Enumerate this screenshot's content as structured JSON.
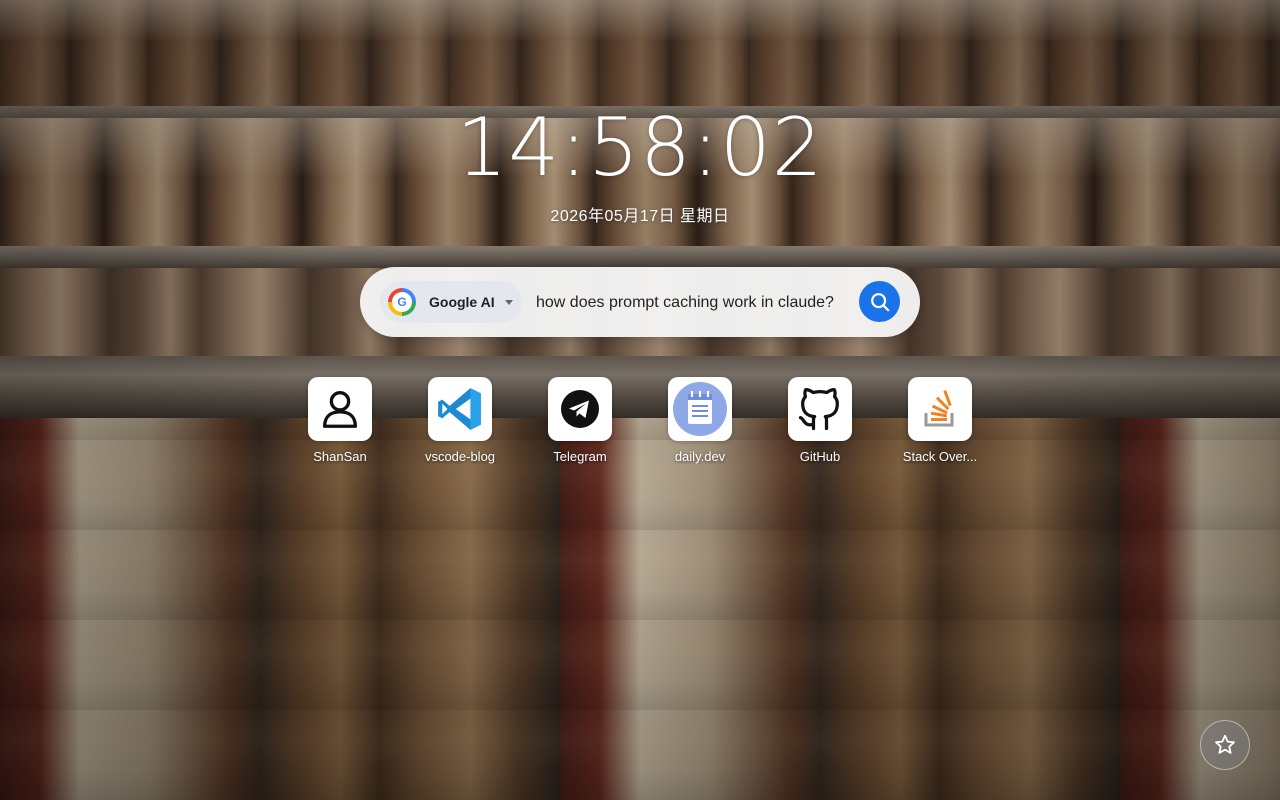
{
  "clock": {
    "time": "14:58:02",
    "date": "2026年05月17日  星期日"
  },
  "search": {
    "engine": {
      "name": "Google AI",
      "logo_letter": "G",
      "icon": "google-ai-logo-icon"
    },
    "query": "how does prompt caching work in claude?",
    "submit_icon": "search-icon",
    "accent_color": "#1a73e8"
  },
  "shortcuts": [
    {
      "label": "ShanSan",
      "icon": "user-icon"
    },
    {
      "label": "vscode-blog",
      "icon": "vscode-icon"
    },
    {
      "label": "Telegram",
      "icon": "telegram-icon"
    },
    {
      "label": "daily.dev",
      "icon": "notepad-icon"
    },
    {
      "label": "GitHub",
      "icon": "github-icon"
    },
    {
      "label": "Stack Over...",
      "icon": "stack-overflow-icon"
    }
  ],
  "favorite_button": {
    "icon": "star-icon"
  }
}
